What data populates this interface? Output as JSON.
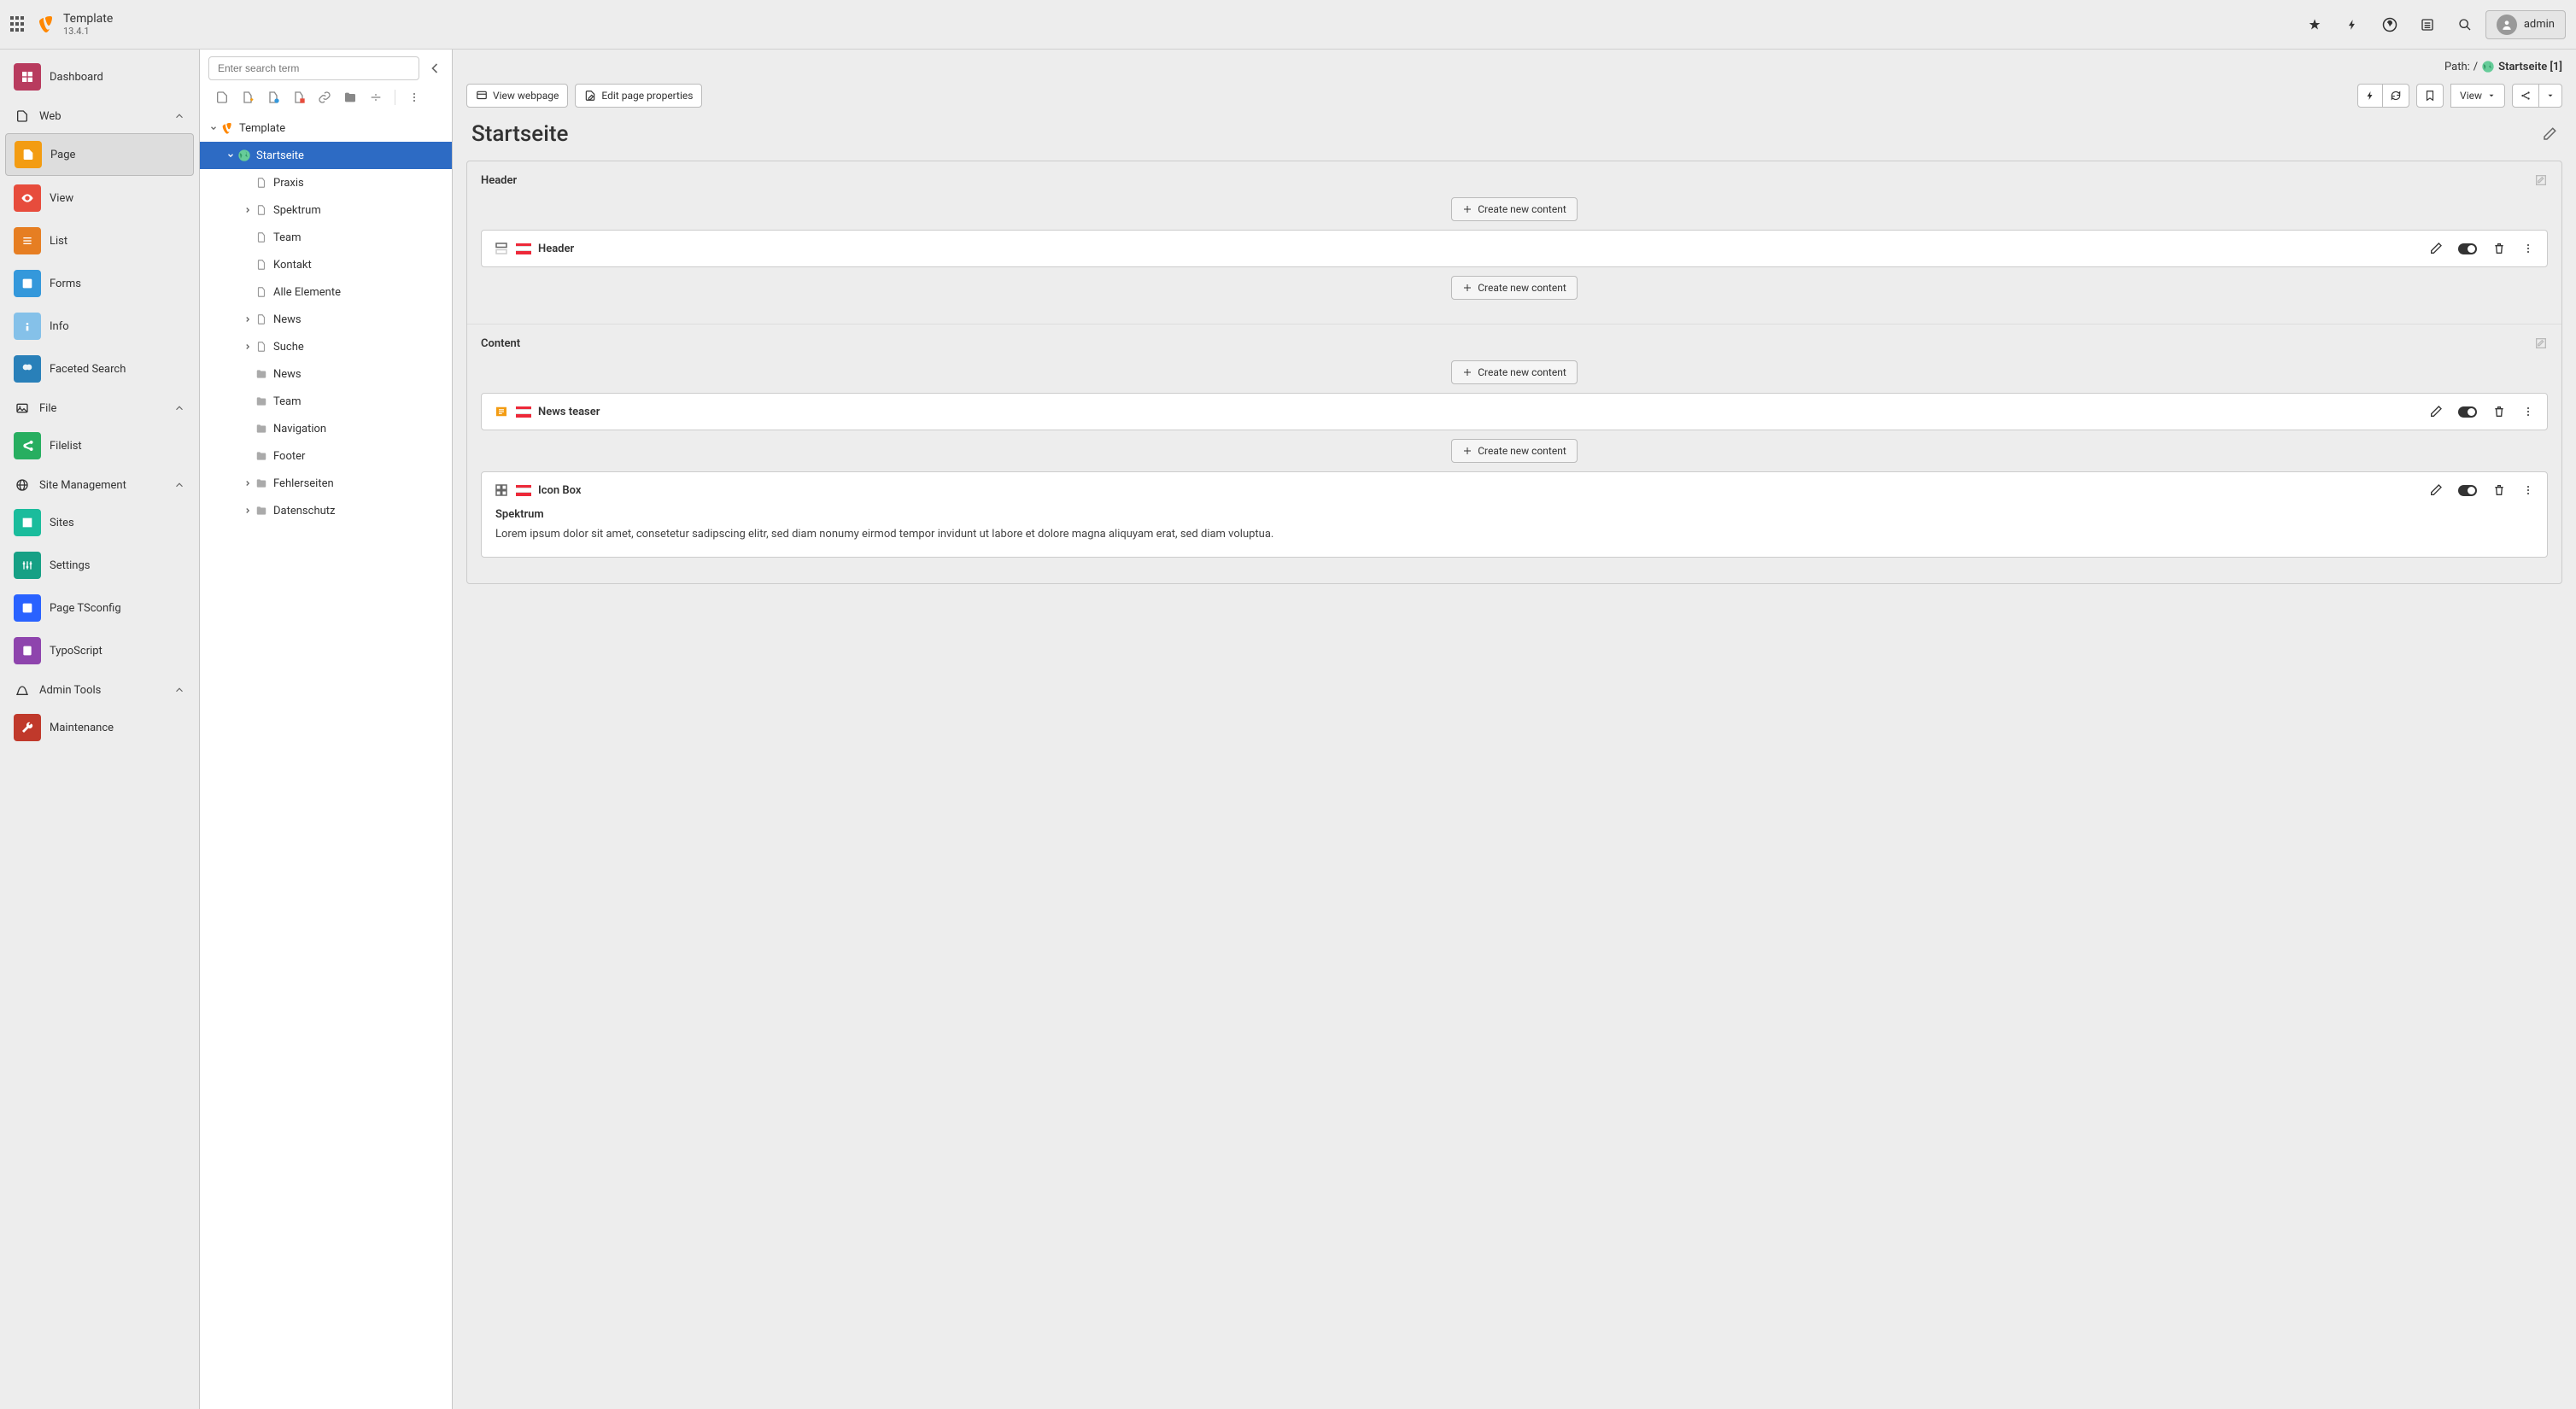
{
  "brand": {
    "name": "Template",
    "version": "13.4.1"
  },
  "user": {
    "name": "admin"
  },
  "modmenu": {
    "dashboard": "Dashboard",
    "groups": {
      "web": "Web",
      "file": "File",
      "site": "Site Management",
      "admin": "Admin Tools"
    },
    "web": {
      "page": "Page",
      "view": "View",
      "list": "List",
      "forms": "Forms",
      "info": "Info",
      "faceted": "Faceted Search"
    },
    "file": {
      "filelist": "Filelist"
    },
    "site": {
      "sites": "Sites",
      "settings": "Settings",
      "tsconfig": "Page TSconfig",
      "typoscript": "TypoScript"
    },
    "admin": {
      "maintenance": "Maintenance"
    }
  },
  "tree": {
    "search_placeholder": "Enter search term",
    "root": "Template",
    "nodes": [
      {
        "label": "Startseite",
        "selected": true,
        "expandable": true,
        "expanded": true,
        "icon": "globe",
        "depth": 1
      },
      {
        "label": "Praxis",
        "icon": "page",
        "depth": 2
      },
      {
        "label": "Spektrum",
        "expandable": true,
        "icon": "page",
        "depth": 2
      },
      {
        "label": "Team",
        "icon": "page",
        "depth": 2
      },
      {
        "label": "Kontakt",
        "icon": "page",
        "depth": 2
      },
      {
        "label": "Alle Elemente",
        "icon": "page",
        "depth": 2
      },
      {
        "label": "News",
        "expandable": true,
        "icon": "page",
        "depth": 2
      },
      {
        "label": "Suche",
        "expandable": true,
        "icon": "page",
        "depth": 2
      },
      {
        "label": "News",
        "icon": "folder",
        "depth": 2
      },
      {
        "label": "Team",
        "icon": "folder",
        "depth": 2
      },
      {
        "label": "Navigation",
        "icon": "folder",
        "depth": 2
      },
      {
        "label": "Footer",
        "icon": "folder",
        "depth": 2
      },
      {
        "label": "Fehlerseiten",
        "expandable": true,
        "icon": "folder",
        "depth": 2
      },
      {
        "label": "Datenschutz",
        "expandable": true,
        "icon": "folder",
        "depth": 2
      }
    ]
  },
  "path": {
    "label": "Path:",
    "sep": "/",
    "current": "Startseite [1]"
  },
  "toolbar": {
    "view_webpage": "View webpage",
    "edit_props": "Edit page properties",
    "view": "View"
  },
  "page": {
    "title": "Startseite",
    "new_content": "Create new content",
    "cols": {
      "header": "Header",
      "content": "Content"
    },
    "elements": {
      "header": {
        "title": "Header"
      },
      "news_teaser": {
        "title": "News teaser"
      },
      "icon_box": {
        "title": "Icon Box",
        "body_title": "Spektrum",
        "body_text": "Lorem ipsum dolor sit amet, consetetur sadipscing elitr, sed diam nonumy eirmod tempor invidunt ut labore et dolore magna aliquyam erat, sed diam voluptua."
      }
    }
  }
}
